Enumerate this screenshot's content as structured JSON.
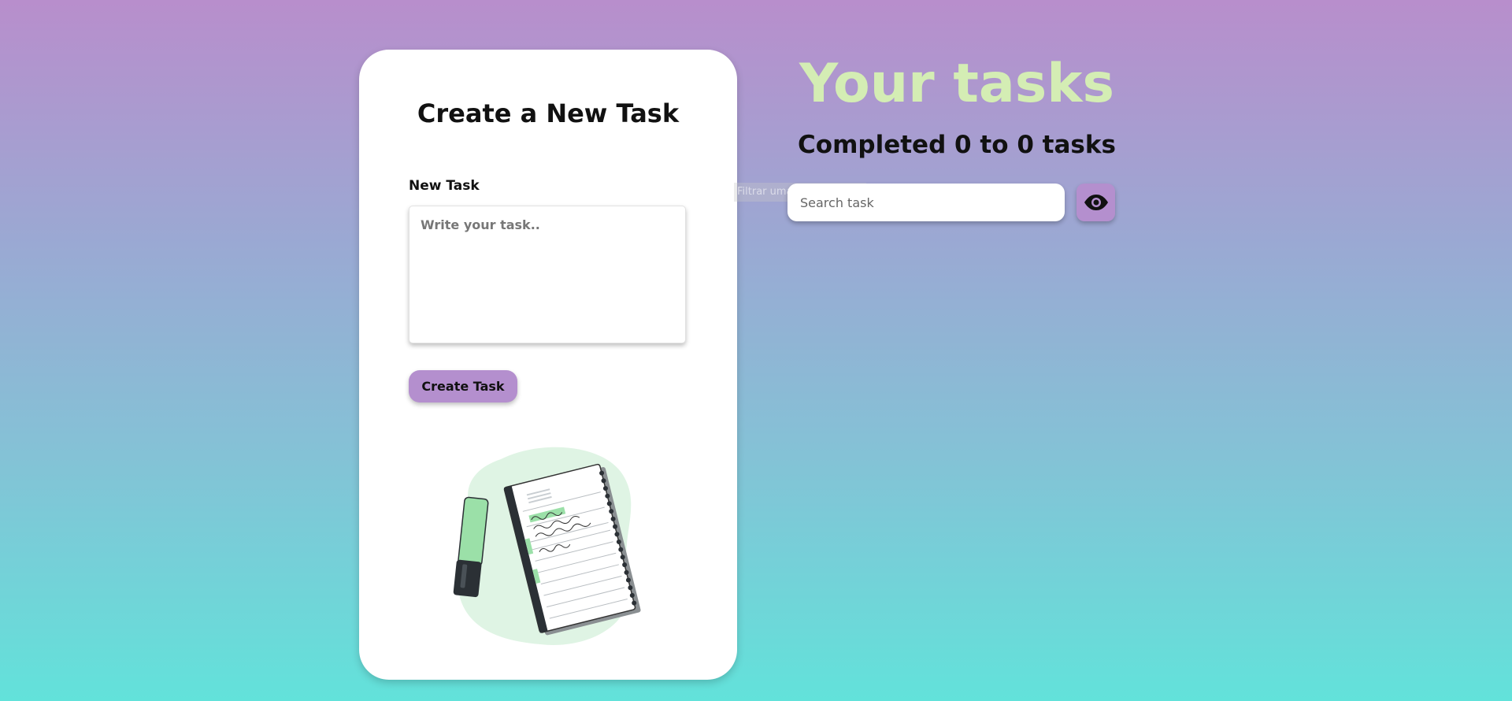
{
  "create_card": {
    "title": "Create a New Task",
    "field_label": "New Task",
    "textarea_placeholder": "Write your task..",
    "button_label": "Create Task"
  },
  "tasks_panel": {
    "title": "Your tasks",
    "completed_text": "Completed 0 to 0 tasks",
    "search_placeholder": "Search task",
    "tooltip_text": "Filtrar uma nova tarefa"
  },
  "icons": {
    "toggle_visibility": "eye-icon",
    "illustration": "notebook-highlighter-illustration"
  },
  "colors": {
    "accent": "#b48fce",
    "title_green": "#d4edb4",
    "gradient_top": "#b88ecc",
    "gradient_bottom": "#62e2da",
    "illustration_green": "#9be0a8"
  }
}
